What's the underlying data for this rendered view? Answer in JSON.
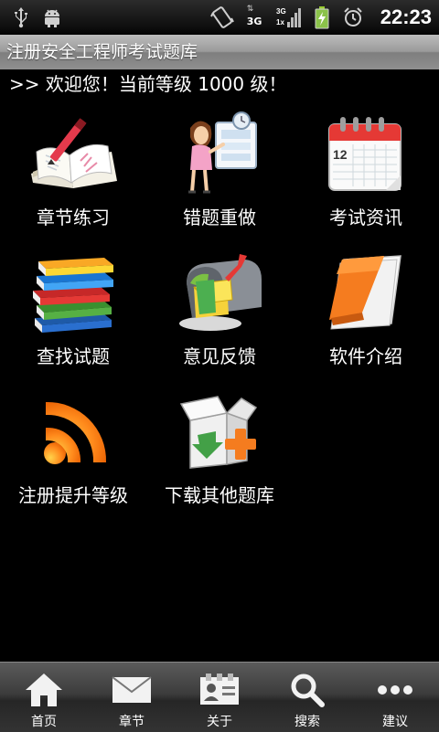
{
  "status_bar": {
    "time": "22:23",
    "network_label": "3G",
    "icons": [
      "usb-icon",
      "android-debug-icon",
      "vibrate-icon",
      "data-3g-icon",
      "signal-icon",
      "battery-charging-icon",
      "alarm-icon"
    ]
  },
  "app": {
    "title": "注册安全工程师考试题库"
  },
  "welcome": {
    "text": ">> 欢迎您！当前等级 1000 级！"
  },
  "grid": {
    "items": [
      {
        "label": "章节练习",
        "icon": "notebook-pen-icon"
      },
      {
        "label": "错题重做",
        "icon": "teacher-board-icon"
      },
      {
        "label": "考试资讯",
        "icon": "calendar-icon",
        "calendar_day": "12"
      },
      {
        "label": "查找试题",
        "icon": "books-stack-icon"
      },
      {
        "label": "意见反馈",
        "icon": "mailbox-icon"
      },
      {
        "label": "软件介绍",
        "icon": "notepad-icon"
      },
      {
        "label": "注册提升等级",
        "icon": "rss-icon"
      },
      {
        "label": "下载其他题库",
        "icon": "package-add-icon"
      }
    ]
  },
  "bottom_nav": {
    "items": [
      {
        "label": "首页",
        "icon": "home-icon"
      },
      {
        "label": "章节",
        "icon": "envelope-icon"
      },
      {
        "label": "关于",
        "icon": "contact-card-icon"
      },
      {
        "label": "搜索",
        "icon": "search-icon"
      },
      {
        "label": "建议",
        "icon": "more-dots-icon"
      }
    ]
  }
}
